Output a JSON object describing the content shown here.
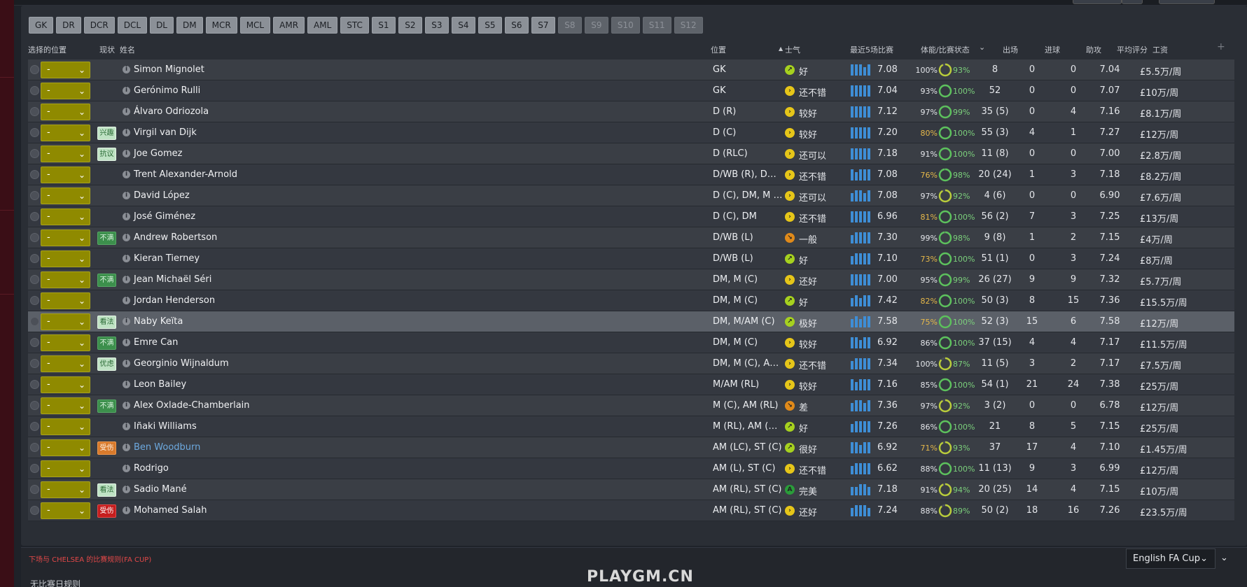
{
  "position_filters": [
    {
      "label": "GK",
      "enabled": true
    },
    {
      "label": "DR",
      "enabled": true
    },
    {
      "label": "DCR",
      "enabled": true
    },
    {
      "label": "DCL",
      "enabled": true
    },
    {
      "label": "DL",
      "enabled": true
    },
    {
      "label": "DM",
      "enabled": true
    },
    {
      "label": "MCR",
      "enabled": true
    },
    {
      "label": "MCL",
      "enabled": true
    },
    {
      "label": "AMR",
      "enabled": true
    },
    {
      "label": "AML",
      "enabled": true
    },
    {
      "label": "STC",
      "enabled": true
    },
    {
      "label": "S1",
      "enabled": true
    },
    {
      "label": "S2",
      "enabled": true
    },
    {
      "label": "S3",
      "enabled": true
    },
    {
      "label": "S4",
      "enabled": true
    },
    {
      "label": "S5",
      "enabled": true
    },
    {
      "label": "S6",
      "enabled": true
    },
    {
      "label": "S7",
      "enabled": true
    },
    {
      "label": "S8",
      "enabled": false
    },
    {
      "label": "S9",
      "enabled": false
    },
    {
      "label": "S10",
      "enabled": false
    },
    {
      "label": "S11",
      "enabled": false
    },
    {
      "label": "S12",
      "enabled": false
    }
  ],
  "columns": {
    "select_position": "选择的位置",
    "status": "现状",
    "name": "姓名",
    "position": "位置",
    "morale": "士气",
    "morale_sort_indicator": "▲",
    "last5": "最近5场比赛",
    "fitness": "体能/比赛状态",
    "apps": "出场",
    "goals": "进球",
    "assists": "助攻",
    "avg_rating": "平均评分",
    "wage": "工资",
    "add_column": "+"
  },
  "colors": {
    "morale_good": "#a6d11f",
    "morale_ok": "#e6c619",
    "morale_poor": "#e08a1a",
    "morale_superb": "#2a9d3a",
    "form_bar": "#3e8ed6",
    "selector": "#8f8a00",
    "fitness_low": "#e6b84a"
  },
  "players": [
    {
      "sel": "-",
      "badge": "",
      "badge_style": "",
      "name": "Simon Mignolet",
      "pos": "GK",
      "morale": "好",
      "morale_style": "good",
      "form": "7.08",
      "bars": [
        4,
        4,
        4,
        3,
        4
      ],
      "fit": "100%",
      "fit_low": false,
      "cond": "93%",
      "ring": 0.93,
      "apps": "8",
      "goals": "0",
      "assists": "0",
      "rating": "7.04",
      "wage": "£5.5万/周"
    },
    {
      "sel": "-",
      "badge": "",
      "badge_style": "",
      "name": "Gerónimo Rulli",
      "pos": "GK",
      "morale": "还不错",
      "morale_style": "ok",
      "form": "7.04",
      "bars": [
        4,
        4,
        4,
        4,
        4
      ],
      "fit": "93%",
      "fit_low": false,
      "cond": "100%",
      "ring": 1,
      "apps": "52",
      "goals": "0",
      "assists": "0",
      "rating": "7.07",
      "wage": "£10万/周"
    },
    {
      "sel": "-",
      "badge": "",
      "badge_style": "",
      "name": "Álvaro Odriozola",
      "pos": "D (R)",
      "morale": "较好",
      "morale_style": "ok",
      "form": "7.12",
      "bars": [
        4,
        4,
        4,
        4,
        4
      ],
      "fit": "97%",
      "fit_low": false,
      "cond": "99%",
      "ring": 0.99,
      "apps": "35 (5)",
      "goals": "0",
      "assists": "4",
      "rating": "7.16",
      "wage": "£8.1万/周"
    },
    {
      "sel": "-",
      "badge": "兴趣",
      "badge_style": "light",
      "name": "Virgil van Dijk",
      "pos": "D (C)",
      "morale": "较好",
      "morale_style": "ok",
      "form": "7.20",
      "bars": [
        4,
        4,
        4,
        4,
        4
      ],
      "fit": "80%",
      "fit_low": true,
      "cond": "100%",
      "ring": 1,
      "apps": "55 (3)",
      "goals": "4",
      "assists": "1",
      "rating": "7.27",
      "wage": "£12万/周"
    },
    {
      "sel": "-",
      "badge": "抗议",
      "badge_style": "light",
      "name": "Joe Gomez",
      "pos": "D (RLC)",
      "morale": "还可以",
      "morale_style": "ok",
      "form": "7.18",
      "bars": [
        4,
        4,
        4,
        4,
        4
      ],
      "fit": "91%",
      "fit_low": false,
      "cond": "100%",
      "ring": 1,
      "apps": "11 (8)",
      "goals": "0",
      "assists": "0",
      "rating": "7.00",
      "wage": "£2.8万/周"
    },
    {
      "sel": "-",
      "badge": "",
      "badge_style": "",
      "name": "Trent Alexander-Arnold",
      "pos": "D/WB (R), DM,...",
      "morale": "还不错",
      "morale_style": "ok",
      "form": "7.08",
      "bars": [
        4,
        3,
        4,
        4,
        4
      ],
      "fit": "76%",
      "fit_low": true,
      "cond": "98%",
      "ring": 0.98,
      "apps": "20 (24)",
      "goals": "1",
      "assists": "3",
      "rating": "7.18",
      "wage": "£8.2万/周"
    },
    {
      "sel": "-",
      "badge": "",
      "badge_style": "",
      "name": "David López",
      "pos": "D (C), DM, M (C)",
      "morale": "还可以",
      "morale_style": "ok",
      "form": "7.08",
      "bars": [
        3,
        4,
        4,
        3,
        4
      ],
      "fit": "97%",
      "fit_low": false,
      "cond": "92%",
      "ring": 0.92,
      "apps": "4 (6)",
      "goals": "0",
      "assists": "0",
      "rating": "6.90",
      "wage": "£7.6万/周"
    },
    {
      "sel": "-",
      "badge": "",
      "badge_style": "",
      "name": "José Giménez",
      "pos": "D (C), DM",
      "morale": "还不错",
      "morale_style": "ok",
      "form": "6.96",
      "bars": [
        4,
        4,
        4,
        4,
        4
      ],
      "fit": "81%",
      "fit_low": true,
      "cond": "100%",
      "ring": 1,
      "apps": "56 (2)",
      "goals": "7",
      "assists": "3",
      "rating": "7.25",
      "wage": "£13万/周"
    },
    {
      "sel": "-",
      "badge": "不满",
      "badge_style": "green",
      "name": "Andrew Robertson",
      "pos": "D/WB (L)",
      "morale": "一般",
      "morale_style": "poor",
      "form": "7.30",
      "bars": [
        3,
        4,
        4,
        4,
        4
      ],
      "fit": "99%",
      "fit_low": false,
      "cond": "98%",
      "ring": 0.98,
      "apps": "9 (8)",
      "goals": "1",
      "assists": "2",
      "rating": "7.15",
      "wage": "£4万/周"
    },
    {
      "sel": "-",
      "badge": "",
      "badge_style": "",
      "name": "Kieran Tierney",
      "pos": "D/WB (L)",
      "morale": "好",
      "morale_style": "good",
      "form": "7.10",
      "bars": [
        3,
        4,
        4,
        4,
        4
      ],
      "fit": "73%",
      "fit_low": true,
      "cond": "100%",
      "ring": 1,
      "apps": "51 (1)",
      "goals": "0",
      "assists": "3",
      "rating": "7.24",
      "wage": "£8万/周"
    },
    {
      "sel": "-",
      "badge": "不满",
      "badge_style": "green",
      "name": "Jean Michaël Séri",
      "pos": "DM, M (C)",
      "morale": "还好",
      "morale_style": "ok",
      "form": "7.00",
      "bars": [
        4,
        4,
        4,
        4,
        4
      ],
      "fit": "95%",
      "fit_low": false,
      "cond": "99%",
      "ring": 0.99,
      "apps": "26 (27)",
      "goals": "9",
      "assists": "9",
      "rating": "7.32",
      "wage": "£5.7万/周"
    },
    {
      "sel": "-",
      "badge": "",
      "badge_style": "",
      "name": "Jordan Henderson",
      "pos": "DM, M (C)",
      "morale": "好",
      "morale_style": "good",
      "form": "7.42",
      "bars": [
        3,
        4,
        3,
        4,
        4
      ],
      "fit": "82%",
      "fit_low": true,
      "cond": "100%",
      "ring": 1,
      "apps": "50 (3)",
      "goals": "8",
      "assists": "15",
      "rating": "7.36",
      "wage": "£15.5万/周"
    },
    {
      "sel": "-",
      "badge": "看法",
      "badge_style": "light",
      "name": "Naby Keïta",
      "pos": "DM, M/AM (C)",
      "morale": "极好",
      "morale_style": "good",
      "form": "7.58",
      "bars": [
        3,
        4,
        3,
        4,
        4
      ],
      "fit": "75%",
      "fit_low": true,
      "cond": "100%",
      "ring": 1,
      "apps": "52 (3)",
      "goals": "15",
      "assists": "6",
      "rating": "7.58",
      "wage": "£12万/周",
      "selected": true
    },
    {
      "sel": "-",
      "badge": "不满",
      "badge_style": "green",
      "name": "Emre Can",
      "pos": "DM, M (C)",
      "morale": "较好",
      "morale_style": "ok",
      "form": "6.92",
      "bars": [
        4,
        4,
        3,
        4,
        4
      ],
      "fit": "86%",
      "fit_low": false,
      "cond": "100%",
      "ring": 1,
      "apps": "37 (15)",
      "goals": "4",
      "assists": "4",
      "rating": "7.17",
      "wage": "£11.5万/周"
    },
    {
      "sel": "-",
      "badge": "优虑",
      "badge_style": "light",
      "name": "Georginio Wijnaldum",
      "pos": "DM, M (C), AM (...",
      "morale": "还不错",
      "morale_style": "ok",
      "form": "7.34",
      "bars": [
        3,
        4,
        4,
        4,
        4
      ],
      "fit": "100%",
      "fit_low": false,
      "cond": "87%",
      "ring": 0.87,
      "apps": "11 (5)",
      "goals": "3",
      "assists": "2",
      "rating": "7.17",
      "wage": "£7.5万/周"
    },
    {
      "sel": "-",
      "badge": "",
      "badge_style": "",
      "name": "Leon Bailey",
      "pos": "M/AM (RL)",
      "morale": "较好",
      "morale_style": "ok",
      "form": "7.16",
      "bars": [
        4,
        3,
        4,
        4,
        4
      ],
      "fit": "85%",
      "fit_low": false,
      "cond": "100%",
      "ring": 1,
      "apps": "54 (1)",
      "goals": "21",
      "assists": "24",
      "rating": "7.38",
      "wage": "£25万/周"
    },
    {
      "sel": "-",
      "badge": "不满",
      "badge_style": "green",
      "name": "Alex Oxlade-Chamberlain",
      "pos": "M (C), AM (RL)",
      "morale": "差",
      "morale_style": "poor",
      "form": "7.36",
      "bars": [
        3,
        4,
        4,
        3,
        4
      ],
      "fit": "97%",
      "fit_low": false,
      "cond": "92%",
      "ring": 0.92,
      "apps": "3 (2)",
      "goals": "0",
      "assists": "0",
      "rating": "6.78",
      "wage": "£12万/周"
    },
    {
      "sel": "-",
      "badge": "",
      "badge_style": "",
      "name": "Iñaki Williams",
      "pos": "M (RL), AM (RLC...",
      "morale": "好",
      "morale_style": "good",
      "form": "7.26",
      "bars": [
        3,
        4,
        4,
        4,
        4
      ],
      "fit": "86%",
      "fit_low": false,
      "cond": "100%",
      "ring": 1,
      "apps": "21",
      "goals": "8",
      "assists": "5",
      "rating": "7.15",
      "wage": "£25万/周"
    },
    {
      "sel": "-",
      "badge": "受伤",
      "badge_style": "orange",
      "name": "Ben Woodburn",
      "name_link": true,
      "pos": "AM (LC), ST (C)",
      "morale": "很好",
      "morale_style": "good",
      "form": "6.92",
      "bars": [
        4,
        4,
        3,
        4,
        4
      ],
      "fit": "71%",
      "fit_low": true,
      "cond": "93%",
      "ring": 0.93,
      "apps": "37",
      "goals": "17",
      "assists": "4",
      "rating": "7.10",
      "wage": "£1.45万/周"
    },
    {
      "sel": "-",
      "badge": "",
      "badge_style": "",
      "name": "Rodrigo",
      "pos": "AM (L), ST (C)",
      "morale": "还不错",
      "morale_style": "ok",
      "form": "6.62",
      "bars": [
        3,
        4,
        4,
        4,
        4
      ],
      "fit": "88%",
      "fit_low": false,
      "cond": "100%",
      "ring": 1,
      "apps": "11 (13)",
      "goals": "9",
      "assists": "3",
      "rating": "6.99",
      "wage": "£12万/周"
    },
    {
      "sel": "-",
      "badge": "看法",
      "badge_style": "light",
      "name": "Sadio Mané",
      "pos": "AM (RL), ST (C)",
      "morale": "完美",
      "morale_style": "superb",
      "form": "7.18",
      "bars": [
        3,
        3,
        4,
        4,
        3
      ],
      "fit": "91%",
      "fit_low": false,
      "cond": "94%",
      "ring": 0.94,
      "apps": "20 (25)",
      "goals": "14",
      "assists": "4",
      "rating": "7.15",
      "wage": "£10万/周"
    },
    {
      "sel": "-",
      "badge": "受伤",
      "badge_style": "red",
      "name": "Mohamed Salah",
      "pos": "AM (RL), ST (C)",
      "morale": "还好",
      "morale_style": "ok",
      "form": "7.24",
      "bars": [
        3,
        4,
        4,
        4,
        3
      ],
      "fit": "88%",
      "fit_low": false,
      "cond": "89%",
      "ring": 0.89,
      "apps": "50 (2)",
      "goals": "18",
      "assists": "16",
      "rating": "7.26",
      "wage": "£23.5万/周"
    }
  ],
  "footer": {
    "match_rules_title": "下场与 CHELSEA 的比赛规则(FA CUP)",
    "no_rules": "无比赛日规则",
    "competition": "English FA Cup"
  },
  "watermark": "PLAYGM.CN"
}
